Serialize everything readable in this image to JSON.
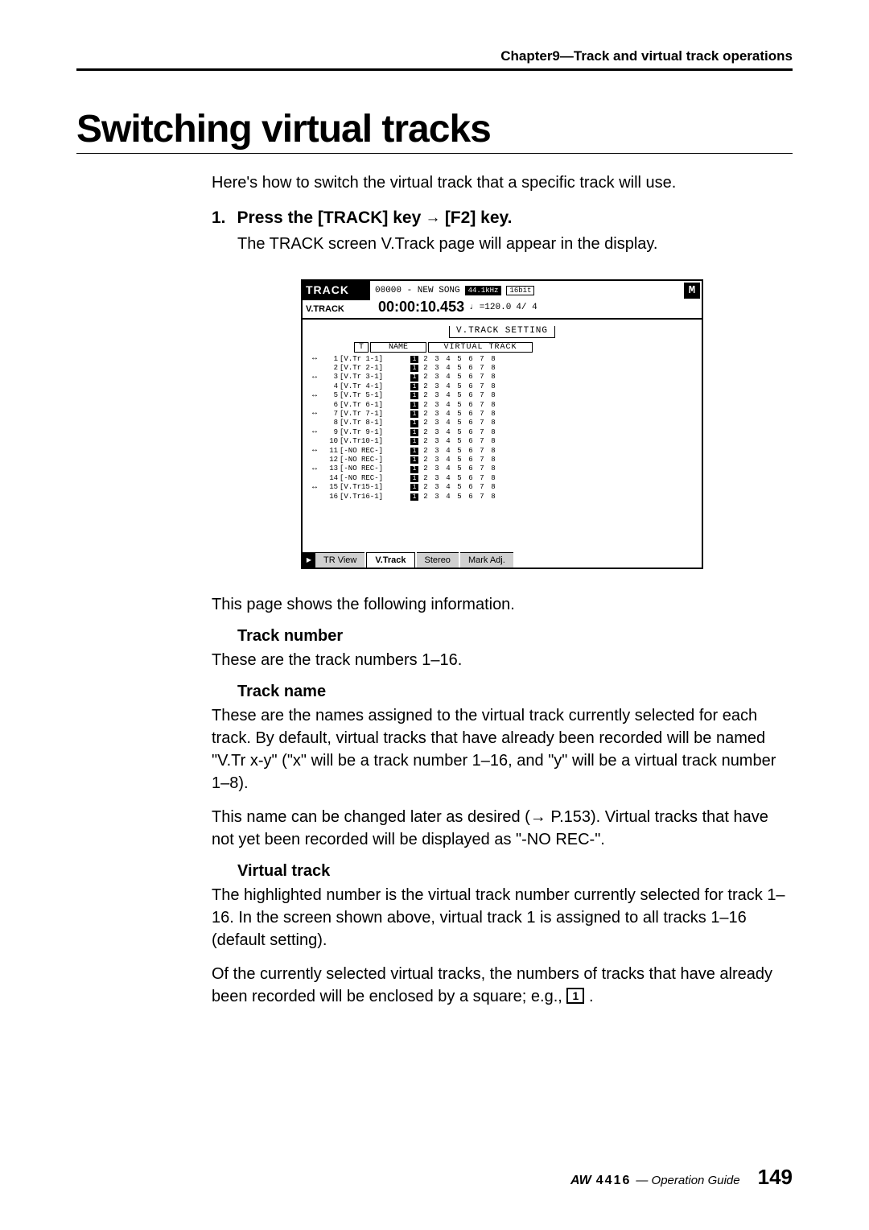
{
  "header": {
    "chapter": "Chapter9—Track and virtual track operations"
  },
  "title": "Switching virtual tracks",
  "intro": "Here's how to switch the virtual track that a specific track will use.",
  "step": {
    "num": "1.",
    "text_a": "Press the [TRACK] key",
    "text_b": "[F2] key.",
    "desc": "The TRACK screen V.Track page will appear in the display."
  },
  "screenshot": {
    "tab_main": "TRACK",
    "tab_sub": "V.TRACK",
    "song": "00000 - NEW SONG",
    "sr": "44.1kHz",
    "bits": "16bit",
    "timecode": "00:00:10.453",
    "tempo": "=120.0",
    "page": "4/ 4",
    "m_icon": "M",
    "section_label": "V.TRACK SETTING",
    "hdr_t": "T",
    "hdr_name": "NAME",
    "hdr_vt": "VIRTUAL TRACK",
    "tracks": [
      {
        "n": "1",
        "name": "[V.Tr 1-1]",
        "sel": 1,
        "row": 0
      },
      {
        "n": "2",
        "name": "[V.Tr 2-1]",
        "sel": 1,
        "row": 1
      },
      {
        "n": "3",
        "name": "[V.Tr 3-1]",
        "sel": 1,
        "row": 2
      },
      {
        "n": "4",
        "name": "[V.Tr 4-1]",
        "sel": 1,
        "row": 3
      },
      {
        "n": "5",
        "name": "[V.Tr 5-1]",
        "sel": 1,
        "row": 4
      },
      {
        "n": "6",
        "name": "[V.Tr 6-1]",
        "sel": 1,
        "row": 5
      },
      {
        "n": "7",
        "name": "[V.Tr 7-1]",
        "sel": 1,
        "row": 6
      },
      {
        "n": "8",
        "name": "[V.Tr 8-1]",
        "sel": 1,
        "row": 7
      },
      {
        "n": "9",
        "name": "[V.Tr 9-1]",
        "sel": 1,
        "row": 8
      },
      {
        "n": "10",
        "name": "[V.Tr10-1]",
        "sel": 1,
        "row": 9
      },
      {
        "n": "11",
        "name": "[-NO REC-]",
        "sel": 1,
        "row": 10
      },
      {
        "n": "12",
        "name": "[-NO REC-]",
        "sel": 1,
        "row": 11
      },
      {
        "n": "13",
        "name": "[-NO REC-]",
        "sel": 1,
        "row": 12
      },
      {
        "n": "14",
        "name": "[-NO REC-]",
        "sel": 1,
        "row": 13
      },
      {
        "n": "15",
        "name": "[V.Tr15-1]",
        "sel": 1,
        "row": 14
      },
      {
        "n": "16",
        "name": "[V.Tr16-1]",
        "sel": 1,
        "row": 15
      }
    ],
    "cols": [
      "1",
      "2",
      "3",
      "4",
      "5",
      "6",
      "7",
      "8"
    ],
    "pair_icon": "↔",
    "tabs": {
      "view": "TR View",
      "vtrack": "V.Track",
      "stereo": "Stereo",
      "mark": "Mark Adj."
    }
  },
  "body": {
    "page_shows": "This page shows the following information.",
    "tracknum_label": "Track number",
    "tracknum_text": "These are the track numbers 1–16.",
    "trackname_label": "Track name",
    "trackname_p1": "These are the names assigned to the virtual track currently selected for each track. By default, virtual tracks that have already been recorded will be named \"V.Tr x-y\" (\"x\" will be a track number 1–16, and \"y\" will be a virtual track number 1–8).",
    "trackname_p2": "This name can be changed later as desired (→ P.153). Virtual tracks that have not yet been recorded will be displayed as \"-NO REC-\".",
    "vtrack_label": "Virtual track",
    "vtrack_p1": "The highlighted number is the virtual track number currently selected for track 1–16. In the screen shown above, virtual track 1 is assigned to all tracks 1–16 (default setting).",
    "vtrack_p2a": "Of the currently selected virtual tracks, the numbers of tracks that have already been recorded will be enclosed by a square; e.g., ",
    "vtrack_sq": "1",
    "vtrack_p2b": " ."
  },
  "footer": {
    "logo": "AW",
    "model": "4416",
    "guide": " — Operation Guide",
    "page": "149"
  }
}
